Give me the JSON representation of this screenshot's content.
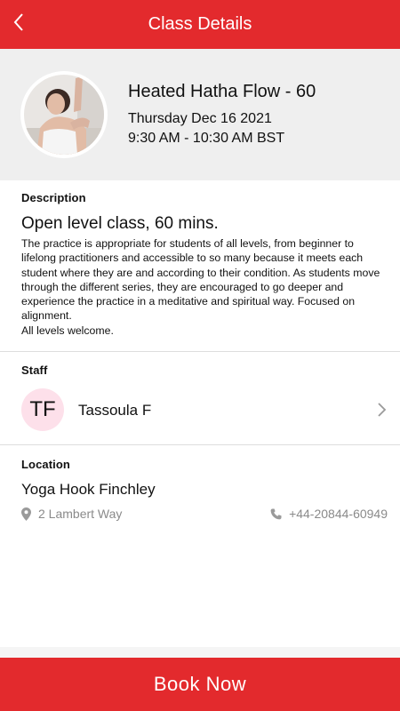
{
  "header": {
    "title": "Class Details",
    "back_icon": "chevron-left-icon",
    "background_color": "#e32a2d"
  },
  "class_info": {
    "photo": "instructor-photo",
    "title": "Heated Hatha Flow - 60",
    "date": "Thursday Dec 16 2021",
    "time": "9:30 AM - 10:30 AM BST"
  },
  "description": {
    "label": "Description",
    "heading": "Open level class, 60 mins.",
    "body": "The practice is appropriate for students of all levels, from beginner to lifelong practitioners and accessible to so many because it meets each student where they are and according to their condition. As students move through the different series, they are encouraged to go deeper and experience the practice in a meditative and spiritual way. Focused on alignment.\nAll levels welcome."
  },
  "staff": {
    "label": "Staff",
    "initials": "TF",
    "name": "Tassoula F",
    "avatar_color": "#fde0ea",
    "chevron_icon": "chevron-right-icon"
  },
  "location": {
    "label": "Location",
    "name": "Yoga Hook Finchley",
    "address": "2 Lambert Way",
    "address_icon": "map-pin-icon",
    "phone": "+44-20844-60949",
    "phone_icon": "phone-icon"
  },
  "book_button": {
    "label": "Book Now",
    "color": "#e32a2d"
  }
}
